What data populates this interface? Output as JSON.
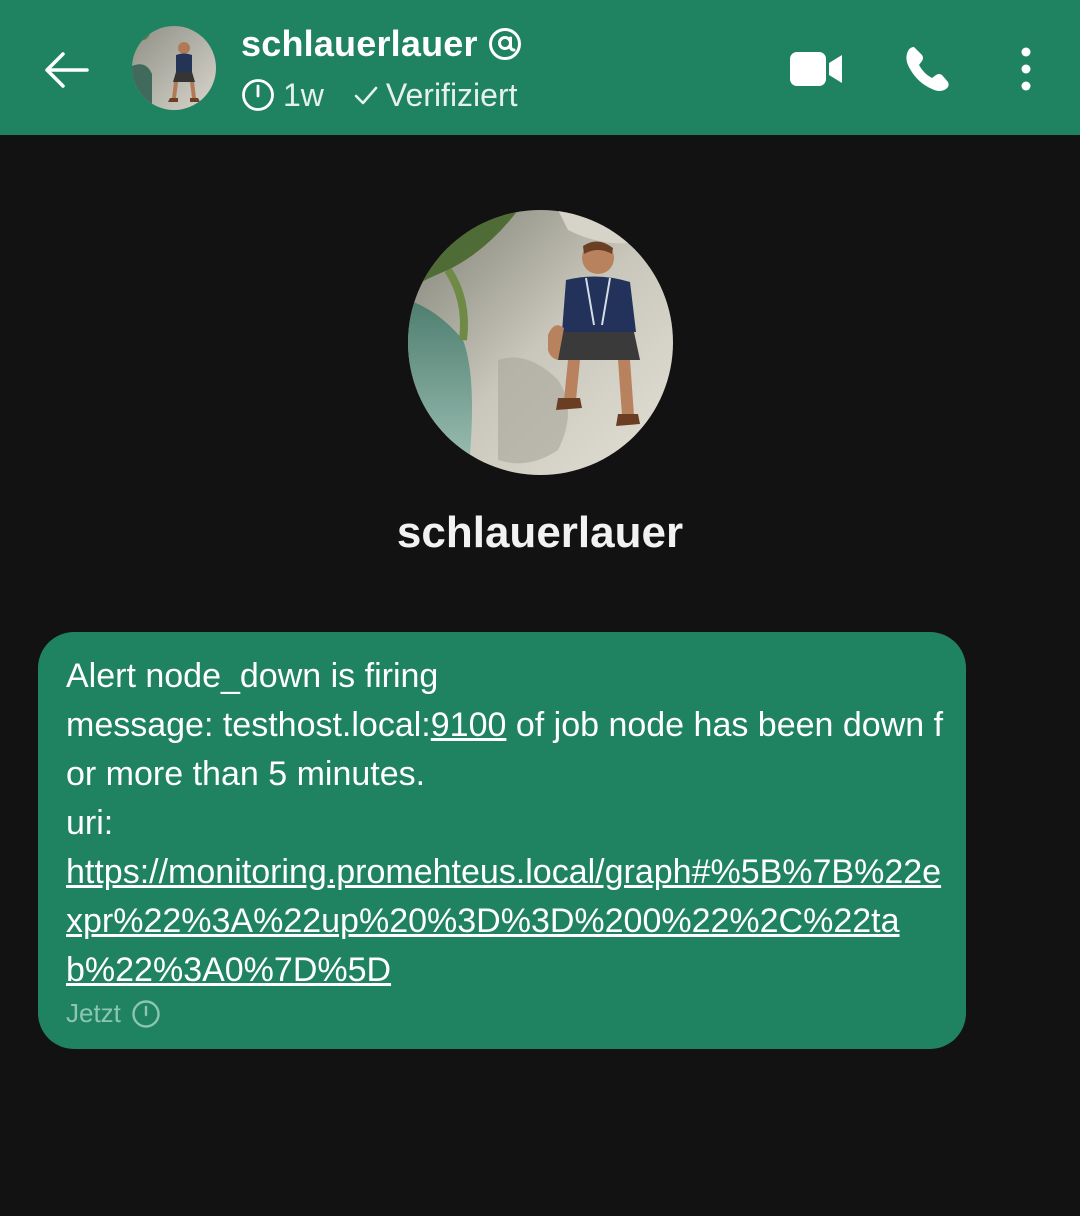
{
  "header": {
    "contact_name": "schlauerlauer",
    "disappearing_timer": "1w",
    "verified_label": "Verifiziert",
    "icons": {
      "back": "arrow-left-icon",
      "username": "at-sign-icon",
      "timer": "timer-icon",
      "verified": "check-icon",
      "video": "video-camera-icon",
      "call": "phone-icon",
      "more": "more-vertical-icon"
    }
  },
  "profile": {
    "name": "schlauerlauer"
  },
  "message": {
    "line1": "Alert node_down is firing",
    "line2_prefix": "message: testhost.local:",
    "line2_link": "9100",
    "line2_suffix": " of job node has been down for more than 5 minutes.",
    "line3": "uri:",
    "uri_link": "https://monitoring.promehteus.local/graph#%5B%7B%22expr%22%3A%22up%20%3D%3D%200%22%2C%22tab%22%3A0%7D%5D",
    "time": "Jetzt",
    "status_icon": "clock-icon"
  },
  "colors": {
    "header_bg": "#1f8261",
    "bubble_bg": "#1f8261",
    "background": "#121212",
    "meta_text": "#8cc6b0"
  }
}
